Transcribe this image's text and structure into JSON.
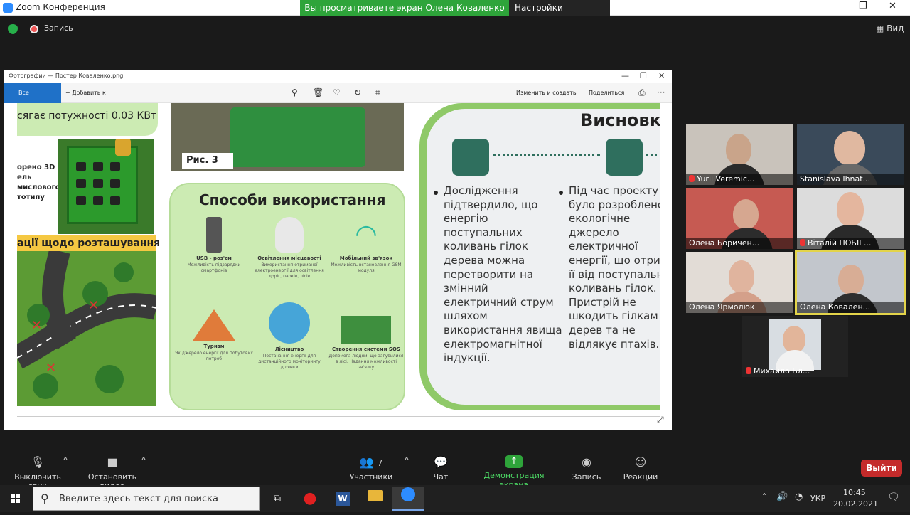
{
  "window": {
    "title": "Zoom Конференция",
    "banner_viewing": "Вы просматриваете экран Олена Коваленко",
    "banner_settings": "Настройки просмотра ⌄",
    "minimize": "—",
    "restore": "❐",
    "close": "✕"
  },
  "meeting_top": {
    "record_label": "Запись",
    "view_label": "Вид"
  },
  "photo_viewer": {
    "title": "Фотографии — Постер Коваленко.png",
    "all_photos": "Все фотографии",
    "add_to": "+ Добавить к",
    "edit_create": "Изменить и создать",
    "share": "Поделиться",
    "more": "···"
  },
  "poster": {
    "power_text": "сягає потужності 0.03 КВт",
    "model_text_1": "орено 3D",
    "model_text_2": "ель",
    "model_text_3": "мислового",
    "model_text_4": "тотипу",
    "location_label": "ації щодо розташування",
    "figure_label": "Рис. 3",
    "uses_title": "Способи використання",
    "uses": [
      {
        "title": "USB - роз'єм",
        "desc": "Можливість підзарядки смартфонів"
      },
      {
        "title": "Освітлення місцевості",
        "desc": "Використання отриманої електроенергії для освітлення доріг, парків, лісів"
      },
      {
        "title": "Мобільний зв'язок",
        "desc": "Можливість встановлення GSM модуля"
      },
      {
        "title": "Туризм",
        "desc": "Як джерело енергії для побутових потреб"
      },
      {
        "title": "Лісництво",
        "desc": "Постачання енергії для дистанційного моніторингу ділянки"
      },
      {
        "title": "Створення системи SOS",
        "desc": "Допомога людям, що загубилися в лісі. Надання можливості зв'язку"
      }
    ],
    "conclusions_title": "Висновки",
    "conclusion_1": "Дослідження підтвердило, що енергію поступальних коливань гілок дерева можна перетворити на змінний електричний струм шляхом використання явища електромагнітної індукції.",
    "conclusion_2": "Під час проекту було розроблено екологічне джерело електричної енергії, що отримує її від поступальних коливань гілок. Пристрій не шкодить гілкам дерев та не відлякує птахів."
  },
  "conclusion_lines_1": [
    "Дослідження",
    "підтвердило, що",
    "енергію",
    "поступальних",
    "коливань гілок",
    "дерева можна",
    "перетворити на",
    "змінний",
    "електричний струм",
    "шляхом",
    "використання явища",
    "електромагнітної",
    "індукції."
  ],
  "conclusion_lines_2": [
    "Під час проекту",
    "було розроблено",
    "екологічне",
    "джерело",
    "електричної",
    "енергії, що отрим",
    "її  від поступальн",
    "коливань гілок.",
    "Пристрій не",
    "шкодить гілкам",
    "дерев та не",
    "відлякує птахів."
  ],
  "participants": [
    {
      "name": "Yurii Veremic...",
      "muted": true
    },
    {
      "name": "Stanislava Ihnat...",
      "muted": false
    },
    {
      "name": "Олена Боричен...",
      "muted": false
    },
    {
      "name": "Віталій ПОБІГ...",
      "muted": true
    },
    {
      "name": "Олена Ярмолюк",
      "muted": false
    },
    {
      "name": "Олена Ковален...",
      "muted": false,
      "active_speaker": true
    },
    {
      "name": "Михайло Бл...",
      "muted": true
    }
  ],
  "toolbar": {
    "mute_label": "Выключить звук",
    "video_label": "Остановить видео",
    "participants_label": "Участники",
    "participants_count": "7",
    "chat_label": "Чат",
    "share_label": "Демонстрация экрана",
    "record_label": "Запись",
    "reactions_label": "Реакции",
    "exit_label": "Выйти"
  },
  "taskbar": {
    "search_placeholder": "Введите здесь текст для поиска",
    "language": "УКР",
    "time": "10:45",
    "date": "20.02.2021"
  },
  "colors": {
    "accent_blue": "#1f71c8",
    "share_green": "#2ea43a",
    "exit_red": "#c42b2b",
    "poster_green": "#ccebb3"
  }
}
